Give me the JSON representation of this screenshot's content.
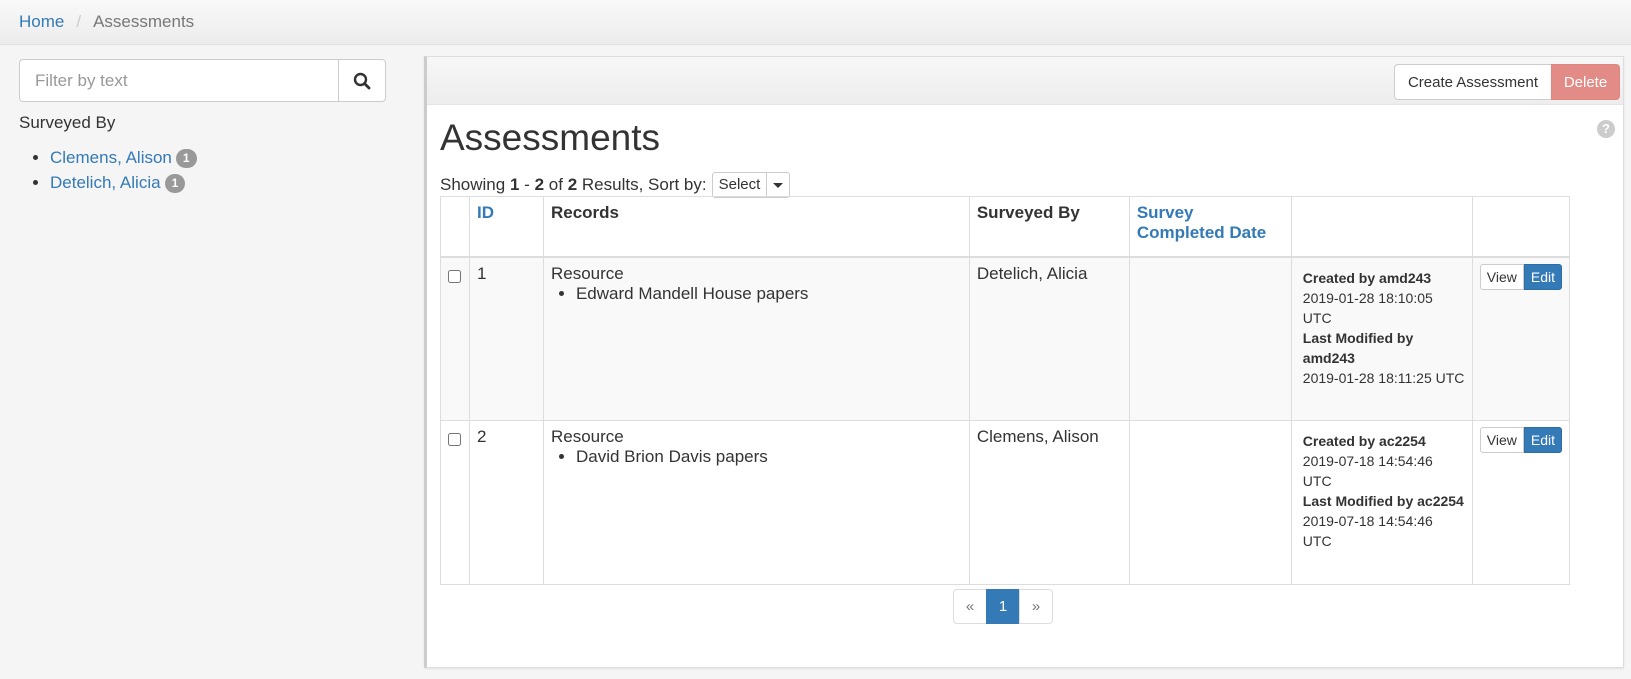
{
  "breadcrumb": {
    "home": "Home",
    "separator": "/",
    "current": "Assessments"
  },
  "sidebar": {
    "filter_placeholder": "Filter by text",
    "search_icon": "search-icon",
    "facet_title": "Surveyed By",
    "facets": [
      {
        "label": "Clemens, Alison",
        "count": "1"
      },
      {
        "label": "Detelich, Alicia",
        "count": "1"
      }
    ]
  },
  "toolbar": {
    "create_label": "Create Assessment",
    "delete_label": "Delete"
  },
  "main": {
    "title": "Assessments",
    "help_icon": "?",
    "summary": {
      "showing": "Showing",
      "from": "1",
      "dash": "-",
      "to": "2",
      "of": "of",
      "total": "2",
      "results_sort": "Results, Sort by:"
    },
    "sort_select": "Select"
  },
  "table": {
    "headers": {
      "id": "ID",
      "records": "Records",
      "surveyed_by": "Surveyed By",
      "completed": "Survey Completed Date"
    },
    "rows": [
      {
        "id": "1",
        "record_type": "Resource",
        "record_item": "Edward Mandell House papers",
        "surveyed_by": "Detelich, Alicia",
        "completed": "",
        "created_by": "Created by amd243",
        "created_at": "2019-01-28 18:10:05 UTC",
        "modified_by": "Last Modified by amd243",
        "modified_at": "2019-01-28 18:11:25 UTC",
        "view": "View",
        "edit": "Edit"
      },
      {
        "id": "2",
        "record_type": "Resource",
        "record_item": "David Brion Davis papers",
        "surveyed_by": "Clemens, Alison",
        "completed": "",
        "created_by": "Created by ac2254",
        "created_at": "2019-07-18 14:54:46 UTC",
        "modified_by": "Last Modified by ac2254",
        "modified_at": "2019-07-18 14:54:46 UTC",
        "view": "View",
        "edit": "Edit"
      }
    ]
  },
  "pagination": {
    "prev": "«",
    "current": "1",
    "next": "»"
  },
  "colors": {
    "link": "#337ab7",
    "danger": "#e38b86",
    "badge": "#999999"
  }
}
